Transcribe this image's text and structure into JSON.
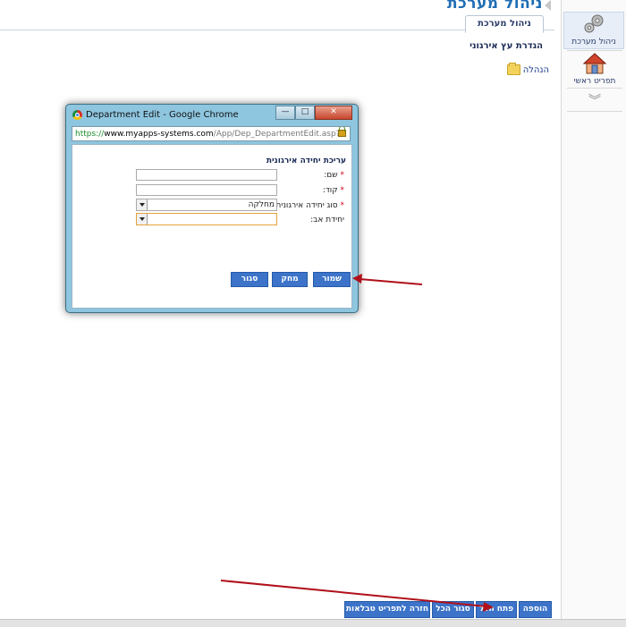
{
  "header": {
    "title": "ניהול מערכת"
  },
  "sidebar": {
    "items": [
      {
        "label": "ניהול מערכת",
        "icon": "gears-icon"
      },
      {
        "label": "תפריט ראשי",
        "icon": "home-icon"
      }
    ],
    "more_icon": "double-chevron-down-icon"
  },
  "tab": {
    "label": "ניהול מערכת"
  },
  "tree": {
    "title": "הגדרת עץ אירגוני",
    "nodes": [
      {
        "label": "הנהלה",
        "icon": "folder-icon"
      }
    ]
  },
  "popup": {
    "window_title": "Department Edit - Google Chrome",
    "url": {
      "scheme": "https://",
      "domain": "www.myapps-systems.com",
      "path": "/App/Dep_DepartmentEdit.asp?"
    },
    "form": {
      "title": "עריכת יחידה אירגונית",
      "fields": [
        {
          "label": "שם:",
          "required": true,
          "value": ""
        },
        {
          "label": "קוד:",
          "required": true,
          "value": ""
        },
        {
          "label": "סוג יחידה אירגונית:",
          "required": true,
          "value": "מחלקה"
        },
        {
          "label": "יחידת אב:",
          "required": false,
          "value": ""
        }
      ]
    },
    "buttons": {
      "save": "שמור",
      "delete": "מחק",
      "close": "סגור"
    },
    "window_buttons": {
      "minimize": "—",
      "maximize": "□",
      "close": "✕"
    }
  },
  "bottom_buttons": {
    "add": "הוספה",
    "open_all": "פתח הכל",
    "close_all": "סגור הכל",
    "back_to_table": "חזרה לתפריט טבלאות"
  },
  "colors": {
    "accent": "#3d74c9",
    "arrow": "#b0101a",
    "title": "#1f6db5"
  }
}
